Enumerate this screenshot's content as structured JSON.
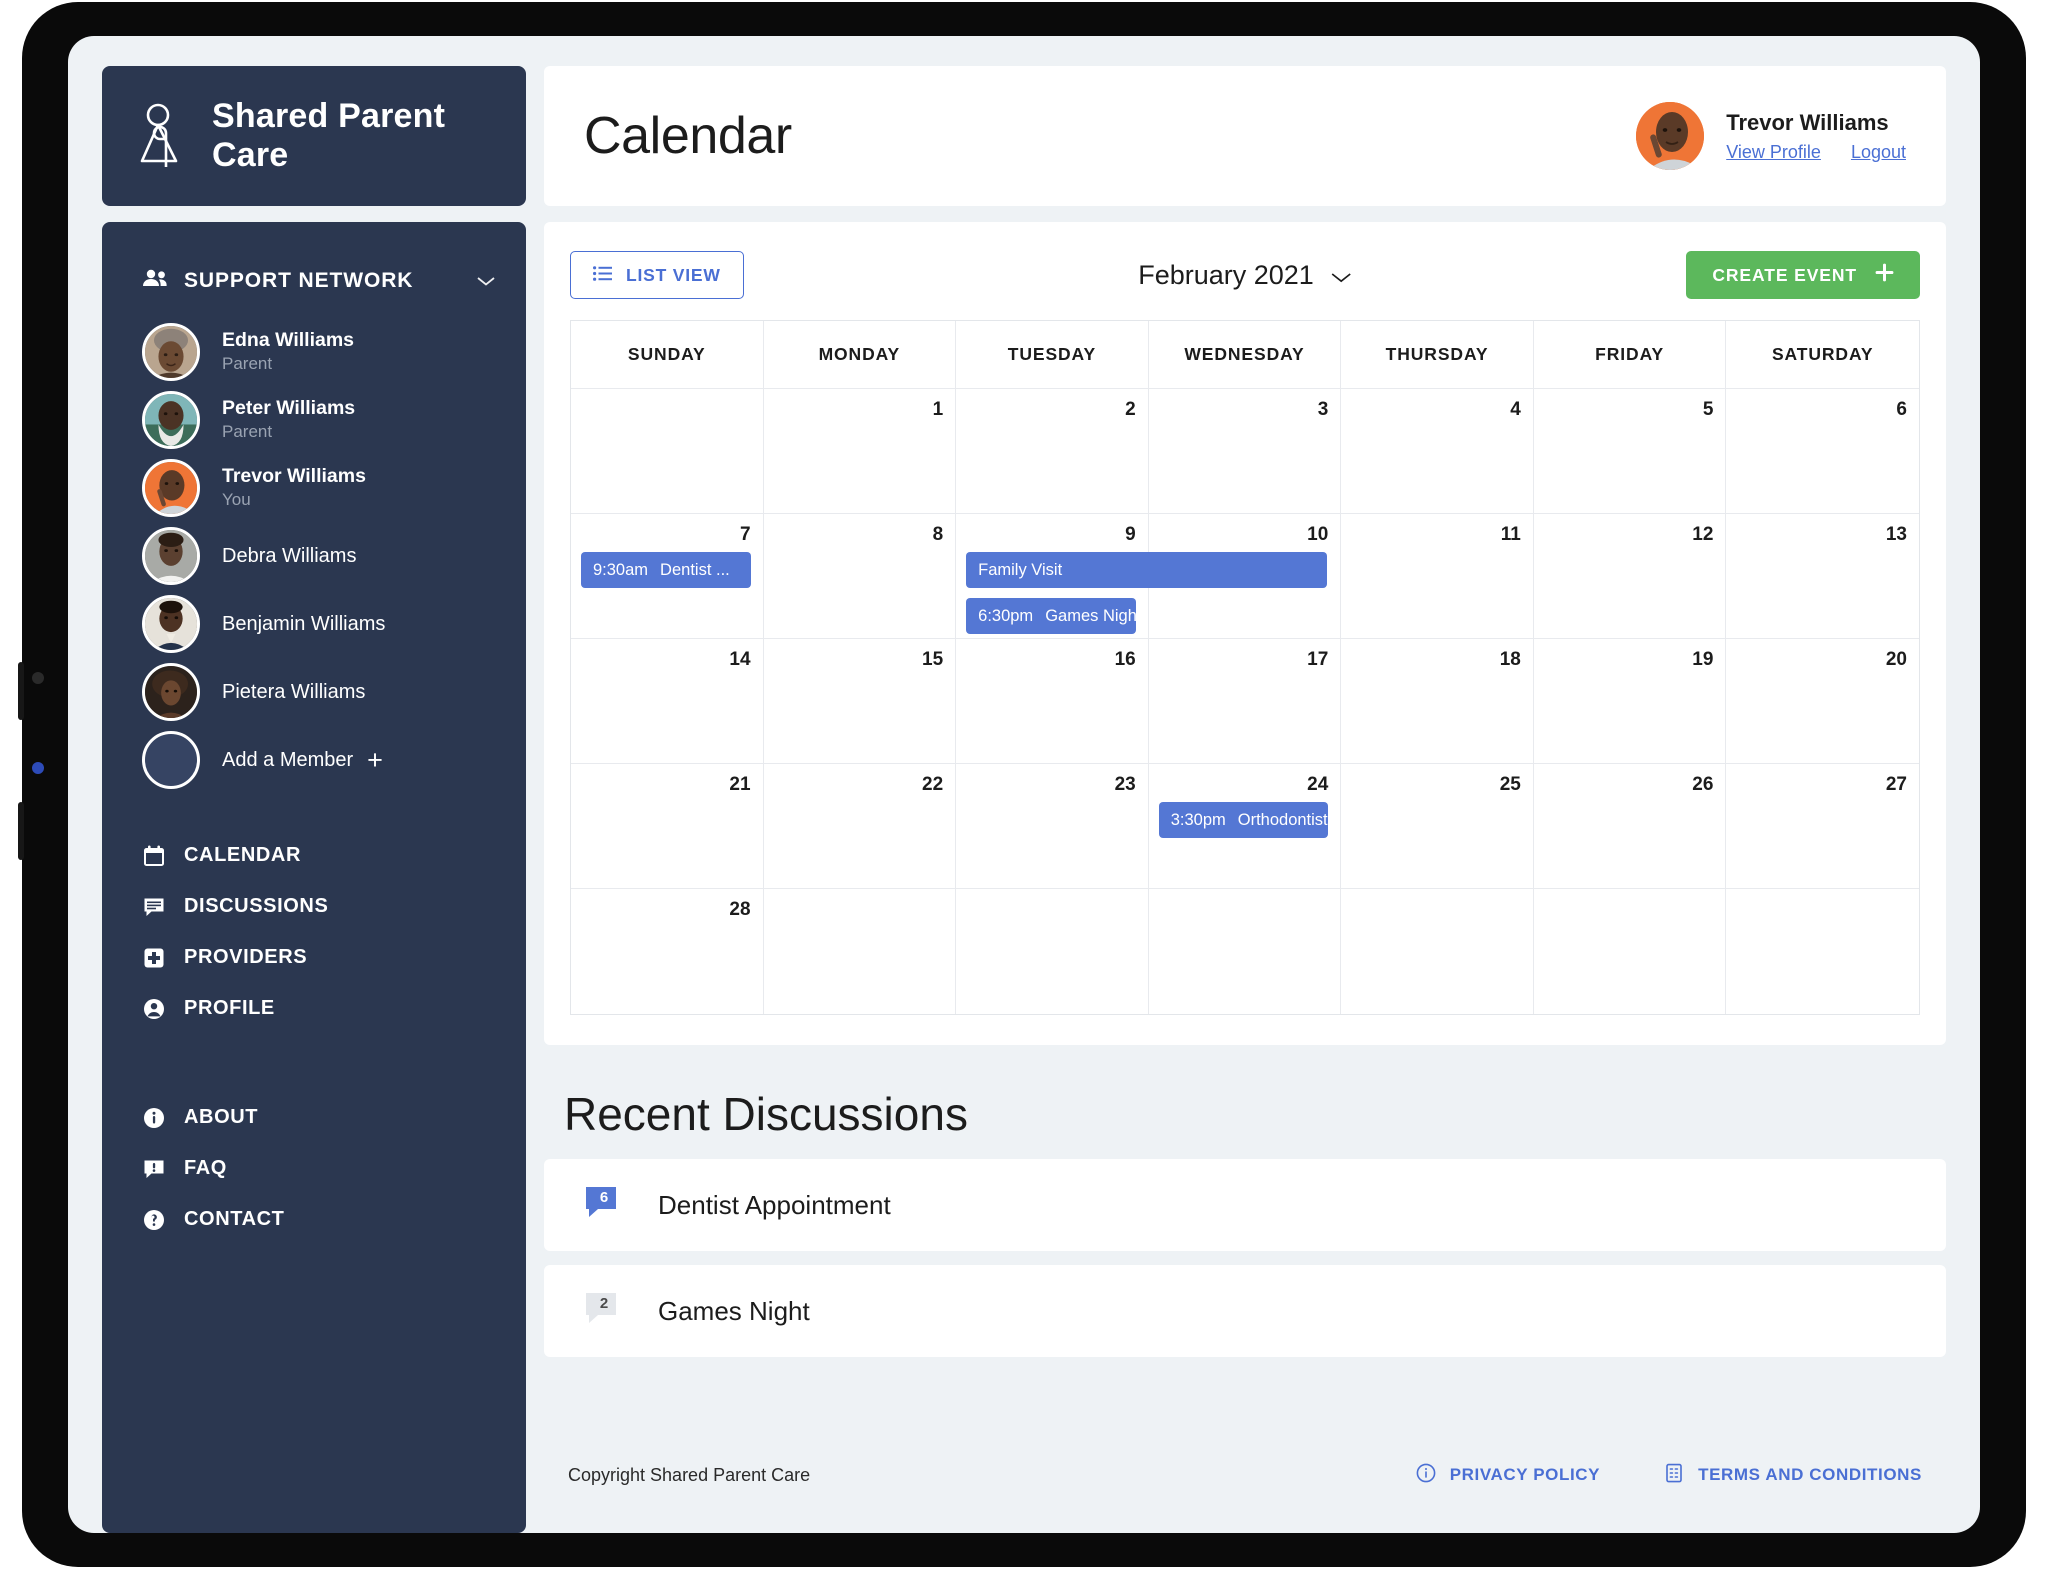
{
  "brand": {
    "name": "Shared Parent Care",
    "logo_icon": "parent-figure-logo-icon"
  },
  "sidebar": {
    "support_network": {
      "label": "SUPPORT NETWORK",
      "icon": "people-icon",
      "chevron": "chevron-down-icon"
    },
    "members": [
      {
        "name": "Edna Williams",
        "role": "Parent"
      },
      {
        "name": "Peter Williams",
        "role": "Parent"
      },
      {
        "name": "Trevor Williams",
        "role": "You"
      },
      {
        "name": "Debra Williams",
        "role": ""
      },
      {
        "name": "Benjamin Williams",
        "role": ""
      },
      {
        "name": "Pietera Williams",
        "role": ""
      }
    ],
    "add_member": {
      "label": "Add a Member",
      "icon": "plus-icon"
    },
    "nav_primary": [
      {
        "label": "CALENDAR",
        "icon": "calendar-icon"
      },
      {
        "label": "DISCUSSIONS",
        "icon": "chat-icon"
      },
      {
        "label": "PROVIDERS",
        "icon": "medical-plus-icon"
      },
      {
        "label": "PROFILE",
        "icon": "person-circle-icon"
      }
    ],
    "nav_secondary": [
      {
        "label": "ABOUT",
        "icon": "info-circle-icon"
      },
      {
        "label": "FAQ",
        "icon": "question-chat-icon"
      },
      {
        "label": "CONTACT",
        "icon": "help-circle-icon"
      }
    ]
  },
  "header": {
    "title": "Calendar",
    "user_name": "Trevor Williams",
    "view_profile": "View Profile",
    "logout": "Logout",
    "avatar_icon": "user-avatar"
  },
  "toolbar": {
    "list_view": "LIST VIEW",
    "list_view_icon": "list-icon",
    "month": "February 2021",
    "month_chevron": "chevron-down-icon",
    "create_event": "CREATE EVENT",
    "create_event_icon": "plus-icon",
    "create_event_color": "#5cb85c",
    "accent_color": "#4a6fd4"
  },
  "calendar": {
    "day_headers": [
      "SUNDAY",
      "MONDAY",
      "TUESDAY",
      "WEDNESDAY",
      "THURSDAY",
      "FRIDAY",
      "SATURDAY"
    ],
    "weeks": [
      [
        "",
        "1",
        "2",
        "3",
        "4",
        "5",
        "6"
      ],
      [
        "7",
        "8",
        "9",
        "10",
        "11",
        "12",
        "13"
      ],
      [
        "14",
        "15",
        "16",
        "17",
        "18",
        "19",
        "20"
      ],
      [
        "21",
        "22",
        "23",
        "24",
        "25",
        "26",
        "27"
      ],
      [
        "28",
        "",
        "",
        "",
        "",
        "",
        ""
      ]
    ],
    "event_color": "#5477d4",
    "events": {
      "dentist": {
        "time": "9:30am",
        "title": "Dentist ..."
      },
      "family_visit": {
        "time": "",
        "title": "Family Visit"
      },
      "games_night": {
        "time": "6:30pm",
        "title": "Games Night ..."
      },
      "orthodontist": {
        "time": "3:30pm",
        "title": "Orthodontist ..."
      }
    }
  },
  "discussions": {
    "title": "Recent Discussions",
    "items": [
      {
        "count": "6",
        "title": "Dentist Appointment",
        "unread": true
      },
      {
        "count": "2",
        "title": "Games Night",
        "unread": false
      }
    ]
  },
  "footer": {
    "copyright": "Copyright Shared Parent Care",
    "links": [
      {
        "label": "PRIVACY POLICY",
        "icon": "info-circle-icon"
      },
      {
        "label": "TERMS AND CONDITIONS",
        "icon": "document-icon"
      }
    ]
  }
}
